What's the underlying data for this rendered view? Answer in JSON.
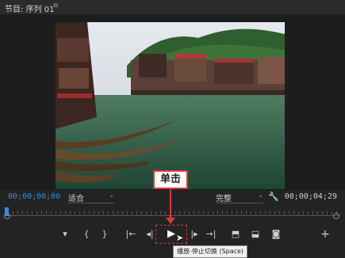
{
  "panel": {
    "title": "节目: 序列 01",
    "menu_icon": "hamburger-icon"
  },
  "timecode": {
    "current": "00;00;00;00",
    "duration": "00;00;04;29"
  },
  "fit": {
    "value": "适合"
  },
  "quality": {
    "value": "完整"
  },
  "controls": {
    "marker": "marker-icon",
    "mark_in": "{",
    "mark_out": "}",
    "goto_in": "goto-in-icon",
    "step_back": "step-back-icon",
    "play": "▶",
    "step_forward": "step-forward-icon",
    "goto_out": "goto-out-icon",
    "lift": "lift-icon",
    "extract": "extract-icon",
    "export_frame": "camera-icon",
    "add": "+"
  },
  "tooltip": "播放-停止切换 (Space)",
  "annotation": {
    "label": "单击"
  },
  "colors": {
    "accent": "#3a8ad8",
    "callout": "#d83a3a"
  }
}
